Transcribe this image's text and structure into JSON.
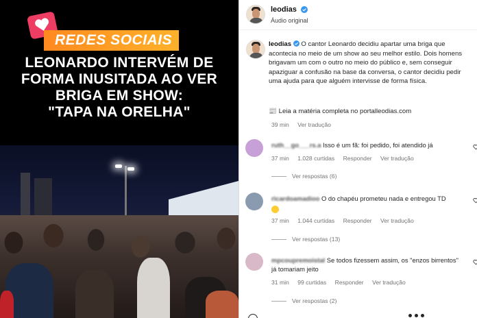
{
  "media": {
    "badge": "REDES SOCIAIS",
    "headline_lines": [
      "LEONARDO INTERVÉM DE",
      "FORMA INUSITADA AO VER",
      "BRIGA EM SHOW:",
      "\"TAPA NA ORELHA\""
    ]
  },
  "post": {
    "username": "leodias",
    "audio": "Áudio original",
    "caption_user": "leodias",
    "caption_text": "O cantor Leonardo decidiu apartar uma briga que acontecia no meio de um show ao seu melhor estilo. Dois homens brigavam um com o outro no meio do público e, sem conseguir apaziguar a confusão na base da conversa, o cantor decidiu pedir uma ajuda para que alguém intervisse de forma física.",
    "link_text": "📰 Leia a matéria completa no portalleodias.com",
    "time": "39 min",
    "translate": "Ver tradução"
  },
  "comments": [
    {
      "user": "ruth__go___rs.a",
      "text": "Isso é um fã: foi pedido, foi atendido já",
      "time": "37 min",
      "likes": "1.028 curtidas",
      "reply": "Responder",
      "translate": "Ver tradução",
      "replies": "Ver respostas (6)",
      "avatar_color": "#c8a0d8"
    },
    {
      "user": "ricardoamadioo",
      "text": "O do chapéu prometeu nada e entregou TD",
      "time": "37 min",
      "likes": "1.044 curtidas",
      "reply": "Responder",
      "translate": "Ver tradução",
      "replies": "Ver respostas (13)",
      "avatar_color": "#8a9bb0"
    },
    {
      "user": "mpcoupremoistal",
      "text": "Se todos fizessem assim, os \"enzos birrentos\" já tomariam jeito",
      "time": "31 min",
      "likes": "99 curtidas",
      "reply": "Responder",
      "translate": "Ver tradução",
      "replies": "Ver respostas (2)",
      "avatar_color": "#d9b8c8"
    }
  ],
  "colors": {
    "verified": "#3897f0",
    "badge_orange": "#ff9a1f",
    "heart_pink": "#ee3d63"
  }
}
